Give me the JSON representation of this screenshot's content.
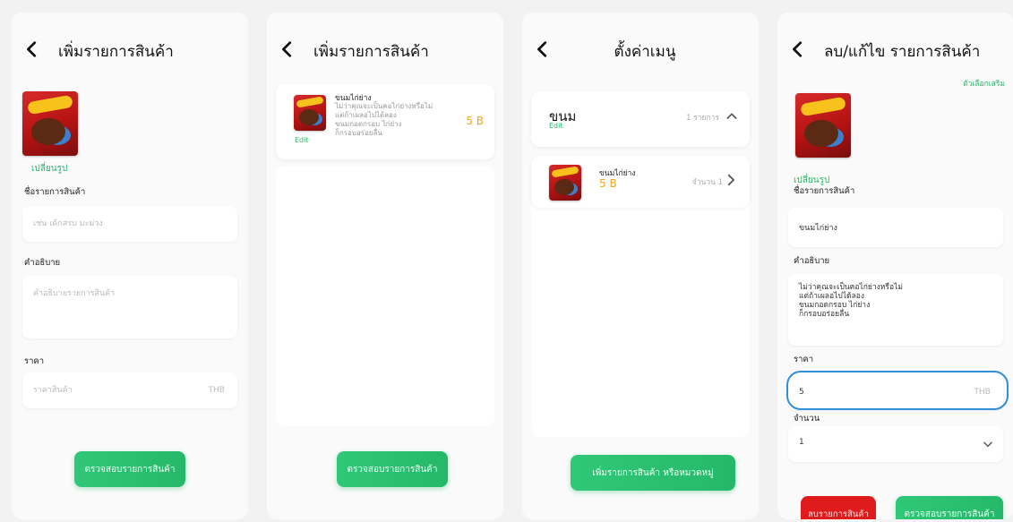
{
  "screens": [
    {
      "title": "เพิ่มรายการสินค้า",
      "change_image": "เปลี่ยนรูป",
      "name_label": "ชื่อรายการสินค้า",
      "name_placeholder": "เช่น เค้กสรบ มะม่วง",
      "desc_label": "คำอธิบาย",
      "desc_placeholder": "คำอธิบายรายการสินค้า",
      "price_label": "ราคา",
      "price_placeholder": "ราคาสินค้า",
      "currency": "THB",
      "submit_label": "ตรวจสอบรายการสินค้า"
    },
    {
      "title": "เพิ่มรายการสินค้า",
      "item_name": "ขนมไก่ย่าง",
      "item_desc": "ไม่ว่าคุณจะเป็นคอไก่ย่างหรือไม่\nแต่ถ้าเผลอไปได้ลอง\nขนมกอดกรอบ ไก่ย่าง\nก็กรอบอร่อยลื่น",
      "item_price": "5 B",
      "edit_label": "Edit",
      "submit_label": "ตรวจสอบรายการสินค้า"
    },
    {
      "title": "ตั้งค่าเมนู",
      "category_name": "ขนม",
      "category_edit": "Edit",
      "category_count": "1 รายการ",
      "item_name": "ขนมไก่ย่าง",
      "item_price": "5 B",
      "item_qty": "จำนวน 1",
      "add_label": "เพิ่มรายการสินค้า หรือหมวดหมู่"
    },
    {
      "title": "ลบ/แก้ไข รายการสินค้า",
      "options_link": "ตัวเลือกเสริม",
      "change_image": "เปลี่ยนรูป",
      "name_label": "ชื่อรายการสินค้า",
      "name_value": "ขนมไก่ย่าง",
      "desc_label": "คำอธิบาย",
      "desc_value": "ไม่ว่าคุณจะเป็นคอไก่ย่างหรือไม่\nแต่ถ้าเผลอไปได้ลอง\nขนมกอดกรอบ ไก่ย่าง\nก็กรอบอร่อยลื่น",
      "price_label": "ราคา",
      "price_value": "5",
      "currency": "THB",
      "qty_label": "จำนวน",
      "qty_value": "1",
      "delete_label": "ลบรายการสินค้า",
      "submit_label": "ตรวจสอบรายการสินค้า"
    }
  ],
  "colors": {
    "green": "#2db66b",
    "orange": "#f2a51c",
    "red": "#e01b1b",
    "focus_blue": "#2f8fd8"
  },
  "icons": {
    "back": "chevron-left-icon",
    "collapse": "chevron-up-icon",
    "next": "chevron-right-icon",
    "dropdown": "chevron-down-icon"
  }
}
